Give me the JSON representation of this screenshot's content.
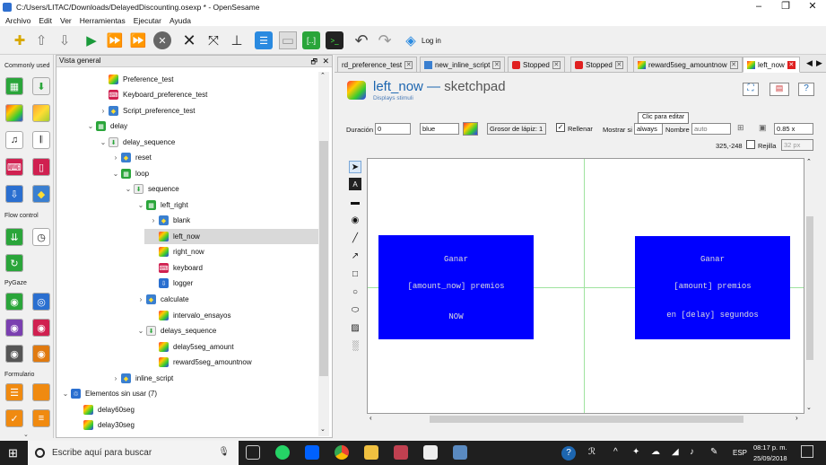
{
  "window": {
    "title": "C:/Users/LITAC/Downloads/DelayedDiscounting.osexp * - OpenSesame",
    "controls": [
      "–",
      "❐",
      "✕"
    ]
  },
  "menu": [
    "Archivo",
    "Edit",
    "Ver",
    "Herramientas",
    "Ejecutar",
    "Ayuda"
  ],
  "toolbar": {
    "login_label": "Log in"
  },
  "left_panel": {
    "sections": [
      "Commonly used",
      "Flow control",
      "PyGaze",
      "Formulario"
    ]
  },
  "overview": {
    "title": "Vista general",
    "items": [
      {
        "label": "Preference_test"
      },
      {
        "label": "Keyboard_preference_test"
      },
      {
        "label": "Script_preference_test"
      },
      {
        "label": "delay"
      },
      {
        "label": "delay_sequence"
      },
      {
        "label": "reset"
      },
      {
        "label": "loop"
      },
      {
        "label": "sequence"
      },
      {
        "label": "left_right"
      },
      {
        "label": "blank"
      },
      {
        "label": "left_now"
      },
      {
        "label": "right_now"
      },
      {
        "label": "keyboard"
      },
      {
        "label": "logger"
      },
      {
        "label": "calculate"
      },
      {
        "label": "intervalo_ensayos"
      },
      {
        "label": "delays_sequence"
      },
      {
        "label": "delay5seg_amount"
      },
      {
        "label": "reward5seg_amountnow"
      },
      {
        "label": "inline_script"
      },
      {
        "label": "Elementos sin usar (7)"
      },
      {
        "label": "delay60seg"
      },
      {
        "label": "delay30seg"
      }
    ]
  },
  "tabs": [
    "rd_preference_test",
    "new_inline_script",
    "Stopped",
    "Stopped",
    "reward5seg_amountnow",
    "left_now"
  ],
  "sketchpad": {
    "name": "left_now",
    "dash": "—",
    "type": "sketchpad",
    "description": "Displays stimuli",
    "duration_label": "Duración",
    "duration_value": "0",
    "color_value": "blue",
    "pen_label": "Grosor de lápiz: 1",
    "fill_label": "Rellenar",
    "show_if_label": "Mostrar si",
    "show_if_value": "always",
    "name_label": "Nombre",
    "name_placeholder": "auto",
    "tooltip": "Clic para editar",
    "zoom": "0.85 x",
    "coords": "325,-248",
    "grid_label": "Rejilla",
    "grid_value": "32 px"
  },
  "canvas": {
    "left_box": {
      "line1": "Ganar",
      "line2": "[amount_now] premios",
      "line3": "NOW"
    },
    "right_box": {
      "line1": "Ganar",
      "line2": "[amount] premios",
      "line3": "en [delay] segundos"
    },
    "box_color": "#0000ff"
  },
  "taskbar": {
    "search_placeholder": "Escribe aquí para buscar",
    "lang": "ESP",
    "time": "08:17 p. m.",
    "date": "25/09/2018"
  }
}
